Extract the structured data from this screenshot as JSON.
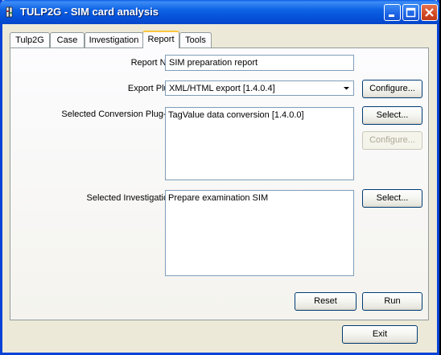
{
  "window": {
    "title": "TULP2G - SIM card analysis"
  },
  "tabs": [
    {
      "label": "Tulp2G"
    },
    {
      "label": "Case"
    },
    {
      "label": "Investigation"
    },
    {
      "label": "Report"
    },
    {
      "label": "Tools"
    }
  ],
  "active_tab": "Report",
  "form": {
    "report_name_label": "Report Name",
    "report_name_value": "SIM preparation report",
    "export_plugin_label": "Export Plug-in",
    "export_plugin_value": "XML/HTML export [1.4.0.4]",
    "conversion_label": "Selected Conversion Plug-in(s)",
    "conversion_items": [
      "TagValue data conversion [1.4.0.0]"
    ],
    "investigation_label": "Selected Investigation(s)",
    "investigation_items": [
      "Prepare examination SIM"
    ]
  },
  "buttons": {
    "configure": "Configure...",
    "select_conversion": "Select...",
    "configure_conversion": "Configure...",
    "select_investigation": "Select...",
    "reset": "Reset",
    "run": "Run",
    "exit": "Exit"
  },
  "colors": {
    "title_bar": "#0a5ce8",
    "window_bg": "#ece9d8",
    "close_button": "#d24922"
  }
}
